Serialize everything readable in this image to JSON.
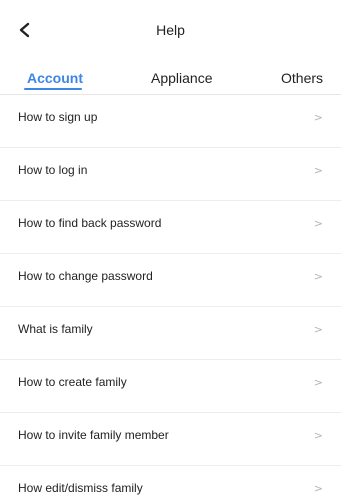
{
  "header": {
    "title": "Help",
    "back_icon": "chevron-left-icon"
  },
  "tabs": [
    {
      "label": "Account",
      "active": true
    },
    {
      "label": "Appliance",
      "active": false
    },
    {
      "label": "Others",
      "active": false
    }
  ],
  "colors": {
    "accent": "#3d86e8",
    "text": "#222222",
    "divider": "#ededed",
    "chevron": "#b5b5b5"
  },
  "items": [
    {
      "label": "How to sign up",
      "chevron": ">"
    },
    {
      "label": "How to log in",
      "chevron": ">"
    },
    {
      "label": "How to find back password",
      "chevron": ">"
    },
    {
      "label": "How to change password",
      "chevron": ">"
    },
    {
      "label": "What is family",
      "chevron": ">"
    },
    {
      "label": "How to create family",
      "chevron": ">"
    },
    {
      "label": "How to invite family member",
      "chevron": ">"
    },
    {
      "label": "How edit/dismiss family",
      "chevron": ">"
    }
  ]
}
